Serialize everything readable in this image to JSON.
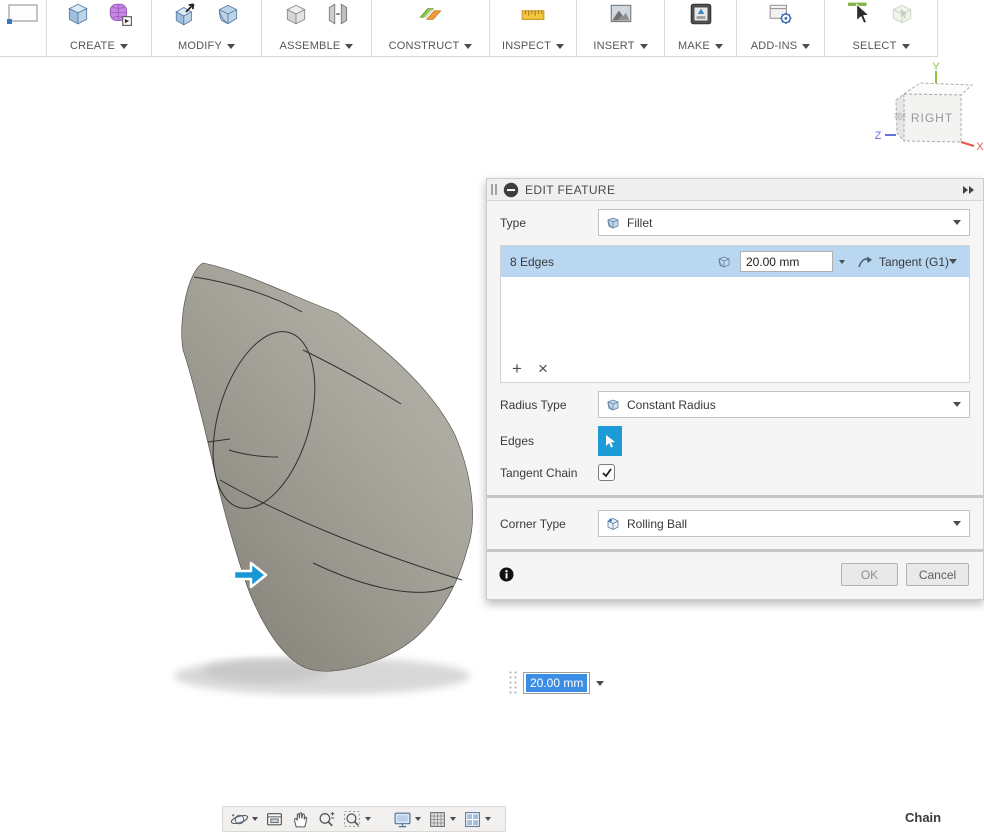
{
  "toolbar": {
    "groups": [
      {
        "label": "",
        "icons": [
          "sketch-rectangle-icon"
        ]
      },
      {
        "label": "CREATE",
        "icons": [
          "solid-box-icon",
          "form-sphere-icon"
        ]
      },
      {
        "label": "MODIFY",
        "icons": [
          "press-pull-icon",
          "fillet-box-icon"
        ]
      },
      {
        "label": "ASSEMBLE",
        "icons": [
          "new-component-icon",
          "joint-icon"
        ]
      },
      {
        "label": "CONSTRUCT",
        "icons": [
          "construction-plane-icon"
        ]
      },
      {
        "label": "INSPECT",
        "icons": [
          "measure-icon"
        ]
      },
      {
        "label": "INSERT",
        "icons": [
          "insert-image-icon"
        ]
      },
      {
        "label": "MAKE",
        "icons": [
          "print-3d-icon"
        ]
      },
      {
        "label": "ADD-INS",
        "icons": [
          "scripts-addins-icon"
        ]
      },
      {
        "label": "SELECT",
        "icons": [
          "select-cursor-icon",
          "window-select-icon"
        ]
      }
    ]
  },
  "viewcube": {
    "front_face": "RIGHT",
    "left_face": "FRONT",
    "axis_x": "X",
    "axis_y": "Y",
    "axis_z": "Z"
  },
  "dialog": {
    "title": "EDIT FEATURE",
    "type_label": "Type",
    "type_value": "Fillet",
    "selection_row": {
      "edges": "8 Edges",
      "radius": "20.00 mm",
      "continuity": "Tangent (G1)"
    },
    "add_label": "+",
    "remove_label": "×",
    "radius_type_label": "Radius Type",
    "radius_type_value": "Constant Radius",
    "edges_label": "Edges",
    "tangent_chain_label": "Tangent Chain",
    "tangent_chain_checked": true,
    "corner_type_label": "Corner Type",
    "corner_type_value": "Rolling Ball",
    "ok_label": "OK",
    "cancel_label": "Cancel"
  },
  "canvas": {
    "dimension_input": {
      "value": "20.00 mm",
      "selected": true
    }
  },
  "nav_bar": {
    "icons": [
      "orbit-icon",
      "look-at-icon",
      "pan-icon",
      "zoom-icon",
      "fit-icon",
      "display-settings-icon",
      "grid-settings-icon",
      "viewports-icon"
    ]
  },
  "status_bar": {
    "chain_label": "Chain"
  },
  "colors": {
    "selection_highlight": "#b9d7f1",
    "accent_blue": "#1d9bd7",
    "text_selection_blue": "#3a8ee6",
    "model_gray": "#a19f96",
    "axis_x_red": "#e8554d",
    "axis_y_green": "#89c540",
    "axis_z_blue": "#6673e0"
  }
}
